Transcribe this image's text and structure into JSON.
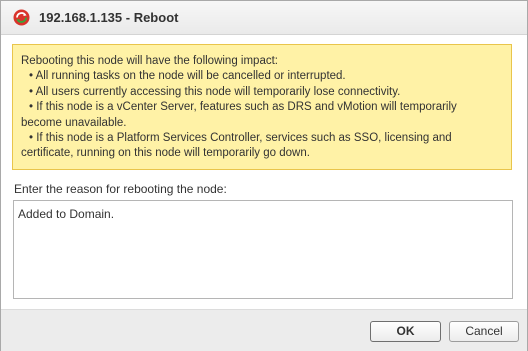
{
  "window": {
    "title": "192.168.1.135 - Reboot",
    "icon": "vcenter-reboot-icon"
  },
  "warning": {
    "intro": "Rebooting this node will have the following impact:",
    "bullets": [
      "• All running tasks on the node will be cancelled or interrupted.",
      "• All users currently accessing this node will temporarily lose connectivity.",
      "• If this node is a vCenter Server, features such as DRS and vMotion will temporarily",
      "become unavailable.",
      "• If this node is a Platform Services Controller, services such as SSO, licensing and",
      "certificate, running on this node will temporarily go down."
    ]
  },
  "reason": {
    "label": "Enter the reason for rebooting the node:",
    "value": "Added to Domain."
  },
  "buttons": {
    "ok": "OK",
    "cancel": "Cancel"
  },
  "colors": {
    "warning_background": "#fff2a6",
    "warning_border": "#e9c54b",
    "icon_red": "#d9342b",
    "icon_green": "#3aa63a"
  }
}
